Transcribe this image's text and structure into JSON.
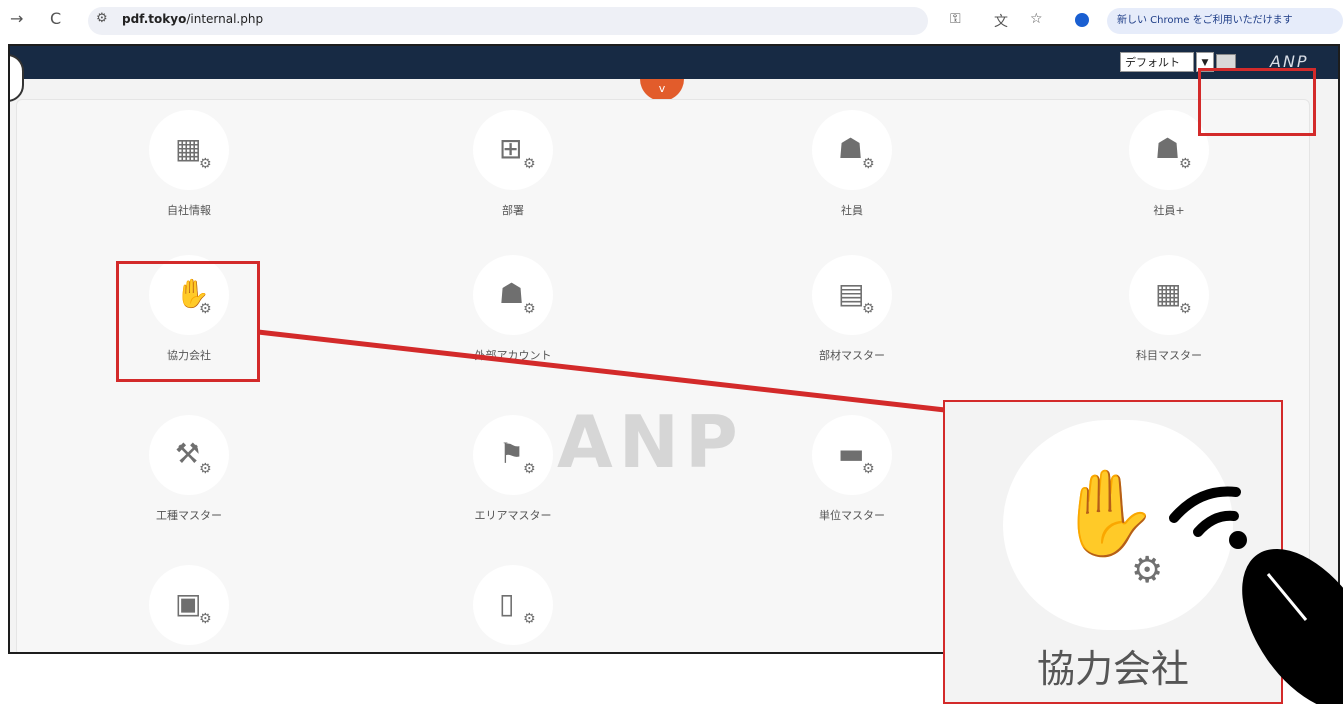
{
  "browser": {
    "url_domain": "pdf.tokyo",
    "url_path": "/internal.php",
    "promo_text": "新しい Chrome をご利用いただけます"
  },
  "header": {
    "select_value": "デフォルト",
    "logo_text": "ANP"
  },
  "menu": {
    "tiles": [
      {
        "label": "自社情報",
        "icon": "building-icon"
      },
      {
        "label": "部署",
        "icon": "org-chart-icon"
      },
      {
        "label": "社員",
        "icon": "employees-icon"
      },
      {
        "label": "社員+",
        "icon": "employees-plus-icon"
      },
      {
        "label": "協力会社",
        "icon": "handshake-icon"
      },
      {
        "label": "外部アカウント",
        "icon": "external-account-icon"
      },
      {
        "label": "部材マスター",
        "icon": "materials-icon"
      },
      {
        "label": "科目マスター",
        "icon": "account-calculator-icon"
      },
      {
        "label": "工種マスター",
        "icon": "tools-icon"
      },
      {
        "label": "エリアマスター",
        "icon": "area-map-icon"
      },
      {
        "label": "単位マスター",
        "icon": "ruler-icon"
      },
      {
        "label": "",
        "icon": "lock-icon"
      },
      {
        "label": "",
        "icon": "document-icon"
      }
    ]
  },
  "watermark_text": "ANP",
  "zoom": {
    "label": "協力会社"
  },
  "colors": {
    "annotation_red": "#d32a2a",
    "header_navy": "#172a44",
    "toggle_orange": "#e25c2b"
  }
}
